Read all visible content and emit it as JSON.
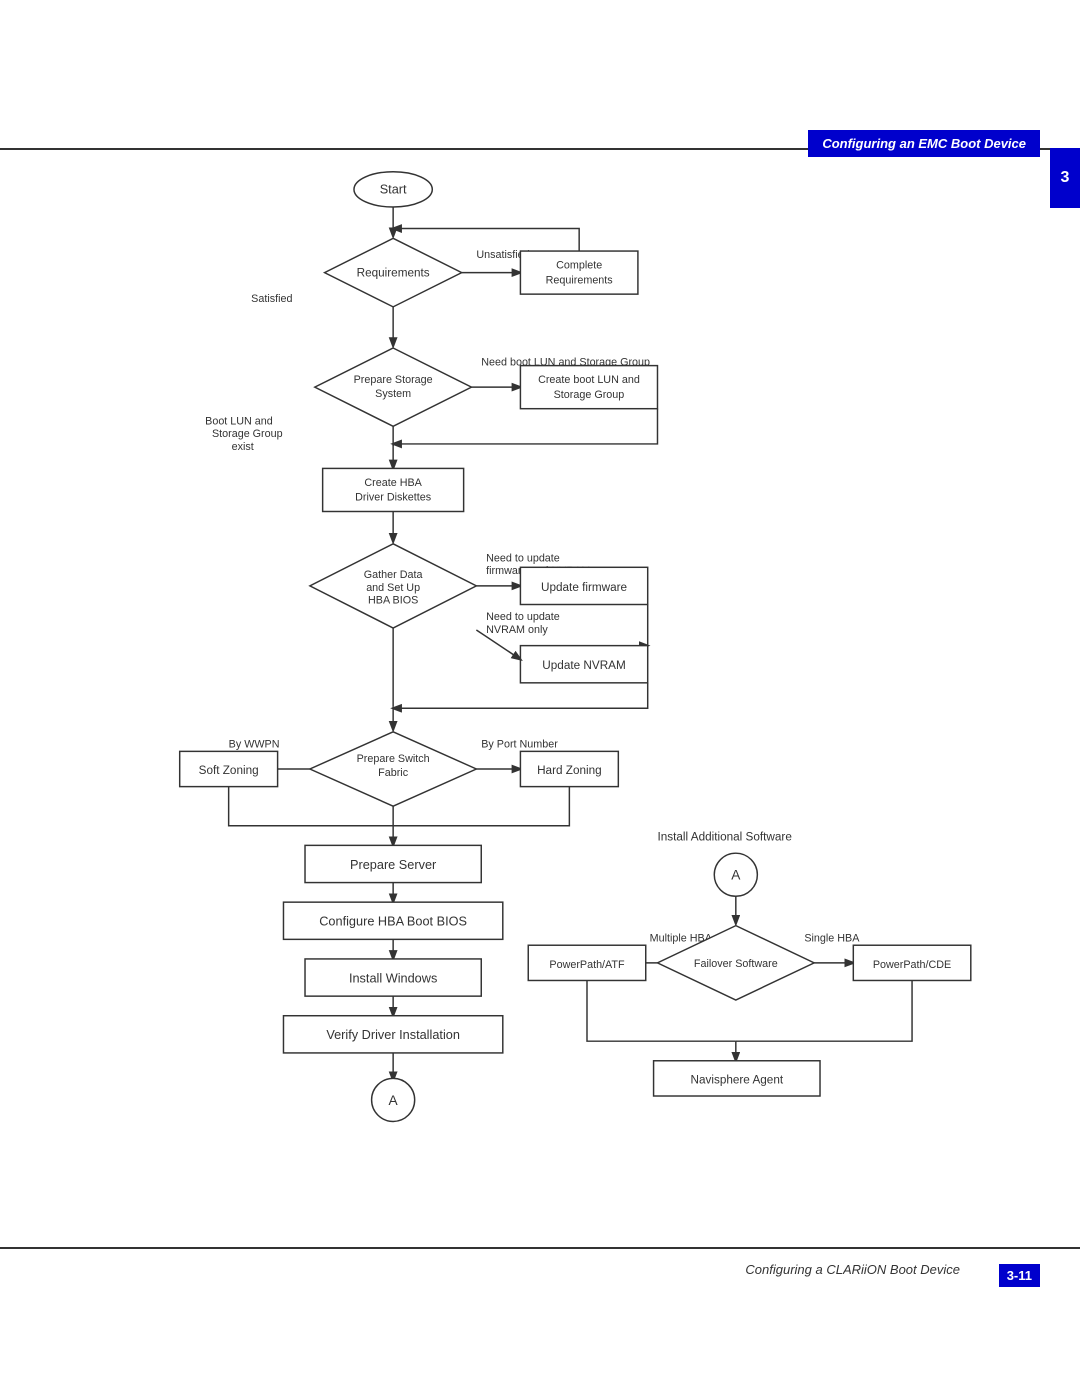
{
  "header": {
    "title": "Configuring an EMC Boot Device",
    "chapter": "3"
  },
  "footer": {
    "text": "Configuring a CLARiiON Boot Device",
    "page": "3-11"
  },
  "flowchart": {
    "nodes": [
      {
        "id": "start",
        "label": "Start",
        "type": "terminal"
      },
      {
        "id": "requirements",
        "label": "Requirements",
        "type": "decision"
      },
      {
        "id": "unsatisfied",
        "label": "Unsatisfied",
        "type": "connector-label"
      },
      {
        "id": "complete_req",
        "label": "Complete\nRequirements",
        "type": "process"
      },
      {
        "id": "satisfied",
        "label": "Satisfied",
        "type": "connector-label"
      },
      {
        "id": "prepare_storage",
        "label": "Prepare Storage\nSystem",
        "type": "decision"
      },
      {
        "id": "need_boot_lun",
        "label": "Need boot LUN and Storage Group",
        "type": "connector-label"
      },
      {
        "id": "create_boot_lun",
        "label": "Create boot LUN and\nStorage Group",
        "type": "process"
      },
      {
        "id": "boot_lun_exist",
        "label": "Boot LUN and\nStorage Group\nexist",
        "type": "connector-label"
      },
      {
        "id": "create_hba",
        "label": "Create HBA\nDriver Diskettes",
        "type": "process"
      },
      {
        "id": "gather_data",
        "label": "Gather Data\nand Set Up\nHBA BIOS",
        "type": "decision"
      },
      {
        "id": "need_update_fw",
        "label": "Need to update\nfirmware and NVRAM",
        "type": "connector-label"
      },
      {
        "id": "update_firmware",
        "label": "Update firmware",
        "type": "process"
      },
      {
        "id": "need_update_nvram",
        "label": "Need to update\nNVRAM only",
        "type": "connector-label"
      },
      {
        "id": "update_nvram",
        "label": "Update NVRAM",
        "type": "process"
      },
      {
        "id": "prepare_switch",
        "label": "Prepare Switch\nFabric",
        "type": "decision"
      },
      {
        "id": "by_wwpn",
        "label": "By WWPN",
        "type": "connector-label"
      },
      {
        "id": "by_port",
        "label": "By Port Number",
        "type": "connector-label"
      },
      {
        "id": "soft_zoning",
        "label": "Soft Zoning",
        "type": "process"
      },
      {
        "id": "hard_zoning",
        "label": "Hard Zoning",
        "type": "process"
      },
      {
        "id": "prepare_server",
        "label": "Prepare Server",
        "type": "process"
      },
      {
        "id": "configure_hba",
        "label": "Configure HBA Boot BIOS",
        "type": "process"
      },
      {
        "id": "install_windows",
        "label": "Install Windows",
        "type": "process"
      },
      {
        "id": "verify_driver",
        "label": "Verify Driver Installation",
        "type": "process"
      },
      {
        "id": "connector_a_left",
        "label": "A",
        "type": "circle-connector"
      },
      {
        "id": "install_additional",
        "label": "Install Additional Software",
        "type": "connector-label"
      },
      {
        "id": "connector_a_right",
        "label": "A",
        "type": "circle-connector"
      },
      {
        "id": "failover_software",
        "label": "Failover Software",
        "type": "decision"
      },
      {
        "id": "multiple_hba",
        "label": "Multiple HBA",
        "type": "connector-label"
      },
      {
        "id": "single_hba",
        "label": "Single HBA",
        "type": "connector-label"
      },
      {
        "id": "powerpath_atf",
        "label": "PowerPath/ATF",
        "type": "process"
      },
      {
        "id": "powerpath_cde",
        "label": "PowerPath/CDE",
        "type": "process"
      },
      {
        "id": "navisphere",
        "label": "Navisphere Agent",
        "type": "process"
      }
    ]
  }
}
